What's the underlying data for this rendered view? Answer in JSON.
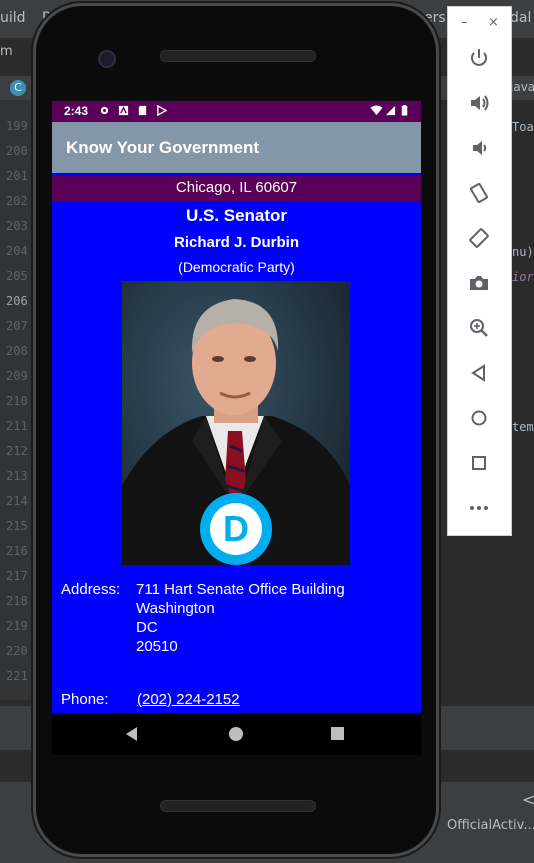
{
  "ide": {
    "menu_left": "uild",
    "menu_r": "R",
    "menu_right1": "ers",
    "menu_right2": "dal",
    "crumb_m": "m",
    "tab_java": "java",
    "code_toa": "Toa",
    "code_nu": "nu)",
    "code_io": "ior",
    "code_tem": "tem",
    "status_file": "OfficialActiv..."
  },
  "gutter": {
    "lines": [
      "199",
      "200",
      "201",
      "202",
      "203",
      "204",
      "205",
      "206",
      "207",
      "208",
      "209",
      "210",
      "211",
      "212",
      "213",
      "214",
      "215",
      "216",
      "217",
      "218",
      "219",
      "220",
      "221"
    ],
    "current": "206"
  },
  "device": {
    "status_time": "2:43"
  },
  "app": {
    "title": "Know Your Government",
    "location": "Chicago, IL 60607",
    "office": "U.S. Senator",
    "name": "Richard J. Durbin",
    "party": "(Democratic Party)",
    "party_logo_letter": "D",
    "address_label": "Address:",
    "address_lines": [
      "711 Hart Senate Office Building",
      "Washington",
      "DC",
      "20510"
    ],
    "phone_label": "Phone:",
    "phone_value": "(202) 224-2152"
  },
  "colors": {
    "status_bar": "#5a0058",
    "app_bar": "#8497a8",
    "content_bg": "#0000ff",
    "democratic_blue": "#00aef0"
  },
  "emulator_toolbar": {
    "minimize": "–",
    "close": "×",
    "buttons": [
      "power-icon",
      "volume-up-icon",
      "volume-down-icon",
      "rotate-left-icon",
      "rotate-right-icon",
      "camera-icon",
      "zoom-icon",
      "back-icon",
      "home-icon",
      "overview-icon",
      "more-icon"
    ]
  }
}
